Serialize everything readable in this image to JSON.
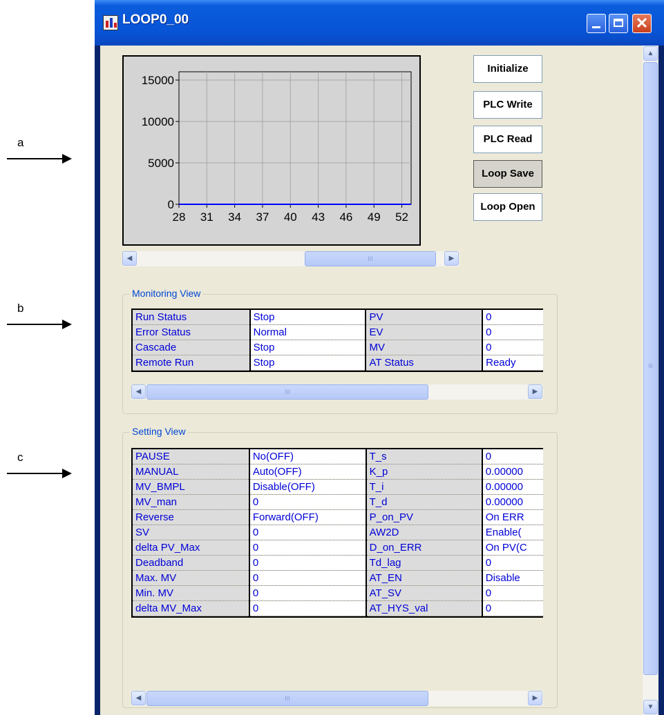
{
  "annotations": [
    "a",
    "b",
    "c"
  ],
  "window": {
    "title": "LOOP0_00",
    "close_glyph": "✕"
  },
  "chart_data": {
    "type": "line",
    "title": "",
    "xlabel": "",
    "ylabel": "",
    "x_ticks": [
      28,
      31,
      34,
      37,
      40,
      43,
      46,
      49,
      52
    ],
    "y_ticks": [
      0,
      5000,
      10000,
      15000
    ],
    "xlim": [
      28,
      53
    ],
    "ylim": [
      0,
      16000
    ],
    "grid": true,
    "series": [
      {
        "x": [
          28,
          53
        ],
        "values": [
          0,
          0
        ],
        "color": "#0000ff"
      }
    ]
  },
  "chart_scroll": {
    "thumb_glyph": "III"
  },
  "buttons": [
    "Initialize",
    "PLC Write",
    "PLC Read",
    "Loop Save",
    "Loop Open"
  ],
  "monitoring": {
    "title": "Monitoring View",
    "rows": [
      [
        "Run Status",
        "Stop",
        "PV",
        "0"
      ],
      [
        "Error Status",
        "Normal",
        "EV",
        "0"
      ],
      [
        "Cascade",
        "Stop",
        "MV",
        "0"
      ],
      [
        "Remote Run",
        "Stop",
        "AT Status",
        "Ready"
      ]
    ],
    "thumb_glyph": "III"
  },
  "setting": {
    "title": "Setting View",
    "rows": [
      [
        "PAUSE",
        "No(OFF)",
        "T_s",
        "0"
      ],
      [
        "MANUAL",
        "Auto(OFF)",
        "K_p",
        "0.00000"
      ],
      [
        "MV_BMPL",
        "Disable(OFF)",
        "T_i",
        "0.00000"
      ],
      [
        "MV_man",
        "0",
        "T_d",
        "0.00000"
      ],
      [
        "Reverse",
        "Forward(OFF)",
        "P_on_PV",
        "On ERR"
      ],
      [
        "SV",
        "0",
        "AW2D",
        "Enable("
      ],
      [
        "delta PV_Max",
        "0",
        "D_on_ERR",
        "On PV(C"
      ],
      [
        "Deadband",
        "0",
        "Td_lag",
        "0"
      ],
      [
        "Max. MV",
        "0",
        "AT_EN",
        "Disable"
      ],
      [
        "Min. MV",
        "0",
        "AT_SV",
        "0"
      ],
      [
        "delta MV_Max",
        "0",
        "AT_HYS_val",
        "0"
      ]
    ],
    "thumb_glyph": "III"
  }
}
